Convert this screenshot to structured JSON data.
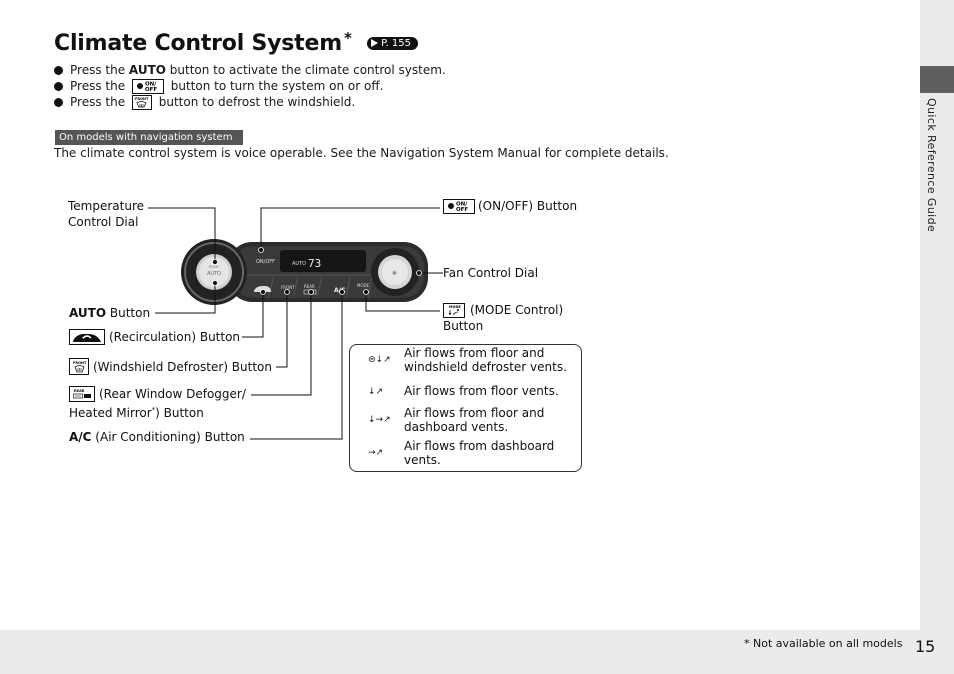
{
  "page": {
    "title": "Climate Control System",
    "title_marker": "*",
    "page_ref": "P. 155",
    "section_tab": "Quick Reference Guide",
    "page_number": "15",
    "footnote": "* Not available on all models"
  },
  "bullets": [
    {
      "pre": "Press the ",
      "strong": "AUTO",
      "post": " button to activate the climate control system."
    },
    {
      "pre": "Press the ",
      "icon": "on-off-icon",
      "icon_text": "ON/OFF",
      "post": " button to turn the system on or off."
    },
    {
      "pre": "Press the ",
      "icon": "front-defrost-icon",
      "icon_text": "FRONT",
      "post": " button to defrost the windshield."
    }
  ],
  "nav_tag": "On models with navigation system",
  "voice_text": "The climate control system is voice operable. See the Navigation System Manual for complete details.",
  "diagram": {
    "display": {
      "mode": "AUTO",
      "temperature": "73"
    },
    "dial_labels": {
      "auto_small": "PUSH",
      "auto_big": "AUTO"
    },
    "panel_buttons": {
      "ac": "A/C",
      "onoff": "ON/OFF",
      "front": "FRONT",
      "rear": "REAR",
      "mode": "MODE"
    },
    "callouts": {
      "temperature_dial_1": "Temperature",
      "temperature_dial_2": "Control Dial",
      "auto_button_strong": "AUTO",
      "auto_button_rest": " Button",
      "onoff_button": "(ON/OFF) Button",
      "fan_dial": "Fan Control Dial",
      "mode_button_1": "(MODE Control)",
      "mode_button_2": "Button",
      "recirc_button": "(Recirculation) Button",
      "defroster_button": "(Windshield Defroster) Button",
      "rear_defog_1": "(Rear Window Defogger/",
      "rear_defog_2a": "Heated Mirror",
      "rear_defog_star": "*",
      "rear_defog_2b": ") Button",
      "ac_strong": "A/C",
      "ac_rest": " (Air Conditioning) Button"
    },
    "mode_legend": [
      {
        "icon": "floor-defrost-mode-icon",
        "glyph": "⊜↓↗",
        "text": "Air flows from floor and windshield defroster vents."
      },
      {
        "icon": "floor-mode-icon",
        "glyph": "↓↗",
        "text": "Air flows from floor vents."
      },
      {
        "icon": "floor-dash-mode-icon",
        "glyph": "↓→↗",
        "text": "Air flows from floor and dashboard vents."
      },
      {
        "icon": "dash-mode-icon",
        "glyph": "→↗",
        "text": "Air flows from dashboard vents."
      }
    ]
  }
}
